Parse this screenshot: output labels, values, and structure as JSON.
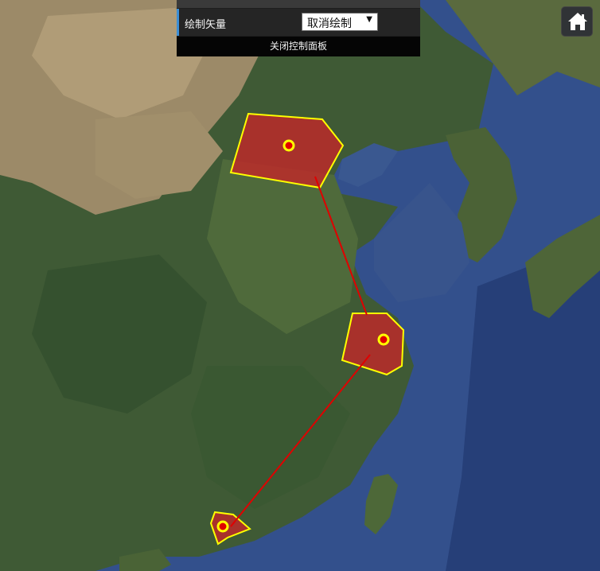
{
  "control_panel": {
    "label": "绘制矢量",
    "select_value": "取消绘制",
    "close_label": "关闭控制面板"
  },
  "home_button": {
    "icon": "home-icon"
  },
  "colors": {
    "polygon_fill": "#c0282a",
    "polygon_stroke": "#ffff00",
    "line": "#e00000",
    "point_fill": "#e00000",
    "point_ring": "#ffff00",
    "panel_accent": "#3b8fd6"
  },
  "map": {
    "polygons": [
      "north-polygon",
      "east-polygon",
      "south-polygon"
    ],
    "points": [
      "north-point",
      "east-point",
      "south-point"
    ],
    "lines": [
      "north-east-line",
      "east-south-line"
    ]
  }
}
